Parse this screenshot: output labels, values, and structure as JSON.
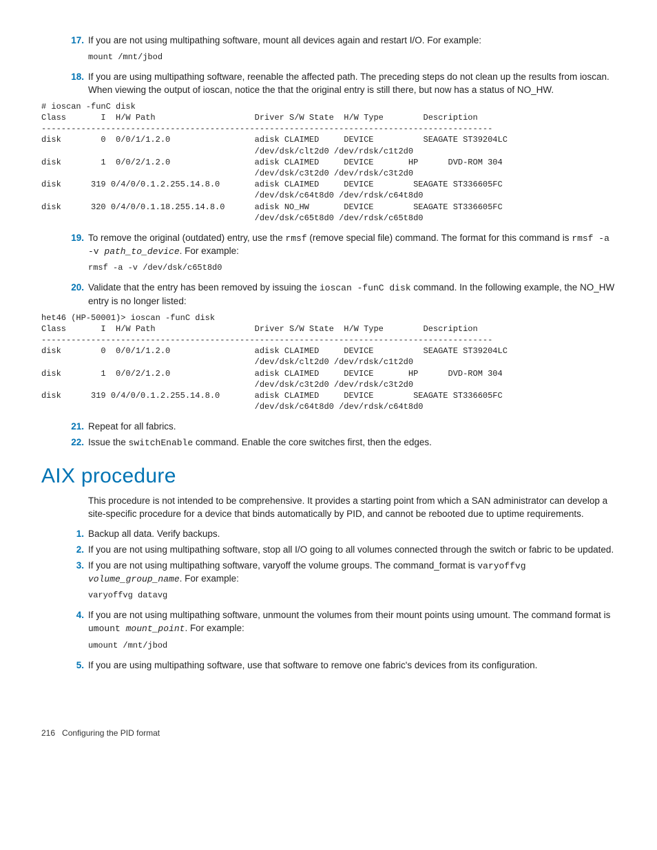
{
  "steps_top": {
    "s17": {
      "num": "17.",
      "text": "If you are not using multipathing software, mount all devices again and restart I/O. For example:"
    },
    "s17_code": "mount /mnt/jbod",
    "s18": {
      "num": "18.",
      "text": "If you are using multipathing software, reenable the affected path. The preceding steps do not clean up the results from ioscan. When viewing the output of ioscan, notice the that the original entry is still there, but now has a status of NO_HW."
    }
  },
  "ioscan1": "# ioscan -funC disk\nClass       I  H/W Path                    Driver S/W State  H/W Type        Description\n-------------------------------------------------------------------------------------------\ndisk        0  0/0/1/1.2.0                 adisk CLAIMED     DEVICE          SEAGATE ST39204LC\n                                           /dev/dsk/clt2d0 /dev/rdsk/c1t2d0\ndisk        1  0/0/2/1.2.0                 adisk CLAIMED     DEVICE       HP      DVD-ROM 304\n                                           /dev/dsk/c3t2d0 /dev/rdsk/c3t2d0\ndisk      319 0/4/0/0.1.2.255.14.8.0       adisk CLAIMED     DEVICE        SEAGATE ST336605FC\n                                           /dev/dsk/c64t8d0 /dev/rdsk/c64t8d0\ndisk      320 0/4/0/0.1.18.255.14.8.0      adisk NO_HW       DEVICE        SEAGATE ST336605FC\n                                           /dev/dsk/c65t8d0 /dev/rdsk/c65t8d0",
  "steps_mid": {
    "s19": {
      "num": "19.",
      "pre": "To remove the original (outdated) entry, use the ",
      "code1": "rmsf",
      "mid1": " (remove special file) command. The format for this command is ",
      "code2": "rmsf -a -v ",
      "ital": "path_to_device",
      "mid2": ". For example:"
    },
    "s19_code": "rmsf -a -v /dev/dsk/c65t8d0",
    "s20": {
      "num": "20.",
      "pre": "Validate that the entry has been removed by issuing the ",
      "code1": "ioscan -funC disk",
      "post": " command. In the following example, the NO_HW entry is no longer listed:"
    }
  },
  "ioscan2": "het46 (HP-50001)> ioscan -funC disk\nClass       I  H/W Path                    Driver S/W State  H/W Type        Description\n-------------------------------------------------------------------------------------------\ndisk        0  0/0/1/1.2.0                 adisk CLAIMED     DEVICE          SEAGATE ST39204LC\n                                           /dev/dsk/clt2d0 /dev/rdsk/c1t2d0\ndisk        1  0/0/2/1.2.0                 adisk CLAIMED     DEVICE       HP      DVD-ROM 304\n                                           /dev/dsk/c3t2d0 /dev/rdsk/c3t2d0\ndisk      319 0/4/0/0.1.2.255.14.8.0       adisk CLAIMED     DEVICE        SEAGATE ST336605FC\n                                           /dev/dsk/c64t8d0 /dev/rdsk/c64t8d0",
  "steps_after": {
    "s21": {
      "num": "21.",
      "text": "Repeat for all fabrics."
    },
    "s22": {
      "num": "22.",
      "pre": "Issue the ",
      "code1": "switchEnable",
      "post": " command. Enable the core switches first, then the edges."
    }
  },
  "section_title": "AIX procedure",
  "section_intro": "This procedure is not intended to be comprehensive. It provides a starting point from which a SAN administrator can develop a site-specific procedure for a device that binds automatically by PID, and cannot be rebooted due to uptime requirements.",
  "aix": {
    "s1": {
      "num": "1.",
      "text": "Backup all data. Verify backups."
    },
    "s2": {
      "num": "2.",
      "text": "If you are not using multipathing software, stop all I/O going to all volumes connected through the switch or fabric to be updated."
    },
    "s3": {
      "num": "3.",
      "pre": "If you are not using multipathing software, varyoff the volume groups. The command_format is ",
      "code1": "varyoffvg ",
      "ital": "volume_group_name",
      "post": ". For example:"
    },
    "s3_code": "varyoffvg datavg",
    "s4": {
      "num": "4.",
      "pre": "If you are not using multipathing software, unmount the volumes from their mount points using umount. The command format is ",
      "code1": "umount ",
      "ital": "mount_point",
      "post": ". For example:"
    },
    "s4_code": "umount /mnt/jbod",
    "s5": {
      "num": "5.",
      "text": "If you are using multipathing software, use that software to remove one fabric's devices from its configuration."
    }
  },
  "footer": {
    "page": "216",
    "title": "Configuring the PID format"
  }
}
